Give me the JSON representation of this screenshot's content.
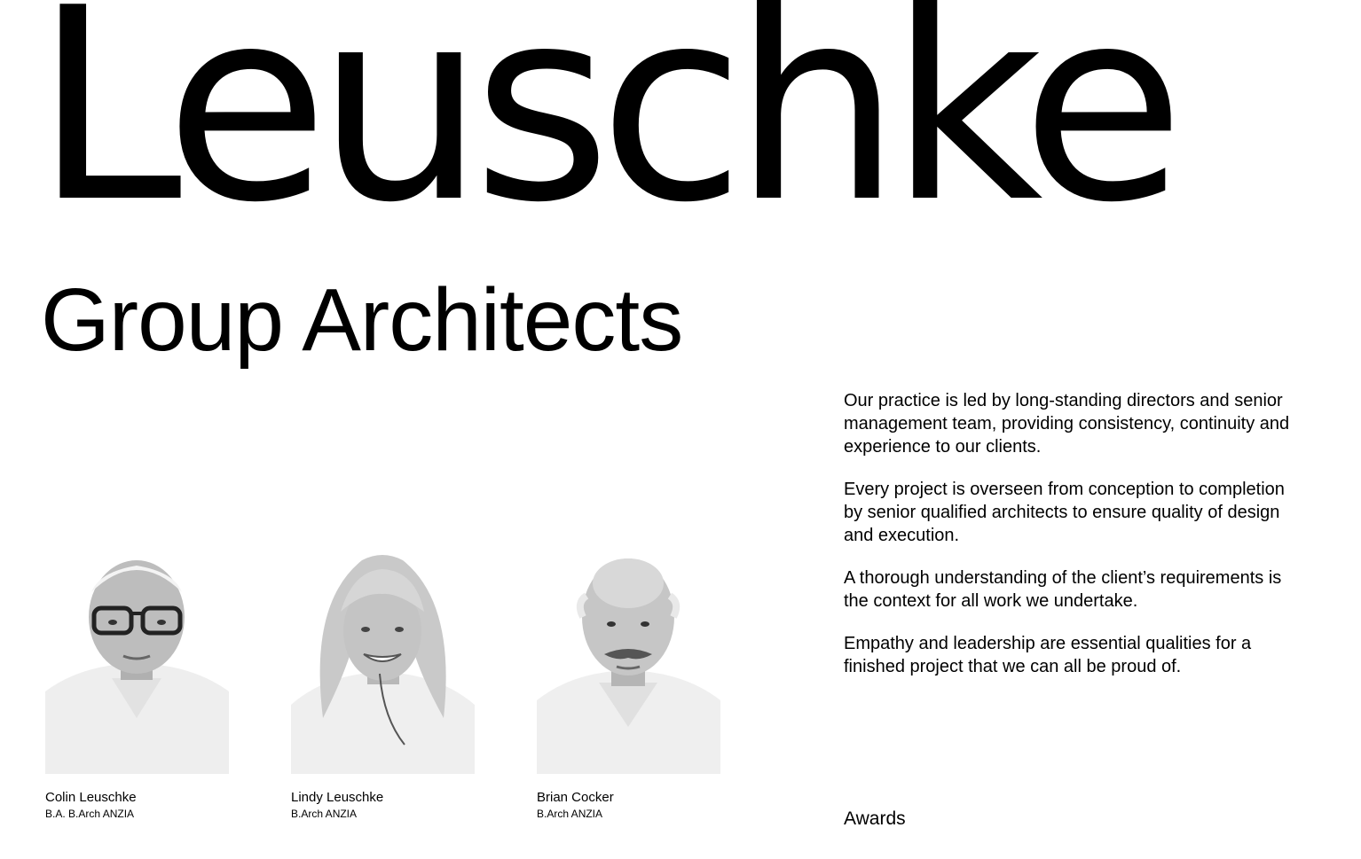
{
  "header": {
    "brand_main": "Leuschke",
    "brand_sub": "Group Architects"
  },
  "team": [
    {
      "name": "Colin Leuschke",
      "credentials": "B.A. B.Arch ANZIA"
    },
    {
      "name": "Lindy Leuschke",
      "credentials": "B.Arch ANZIA"
    },
    {
      "name": "Brian Cocker",
      "credentials": "B.Arch ANZIA"
    }
  ],
  "about": {
    "paragraphs": [
      "Our practice is led by long-standing directors and senior management team, providing consistency, continuity and experience to our clients.",
      "Every project is overseen from conception to completion by senior qualified architects to ensure quality of design and execution.",
      "A thorough understanding of the client’s requirements is the context for all work we undertake.",
      "Empathy and leadership are essential qualities for a finished project that we can all be proud of."
    ]
  },
  "awards": {
    "label": "Awards"
  },
  "colors": {
    "text": "#000000",
    "background": "#ffffff"
  }
}
